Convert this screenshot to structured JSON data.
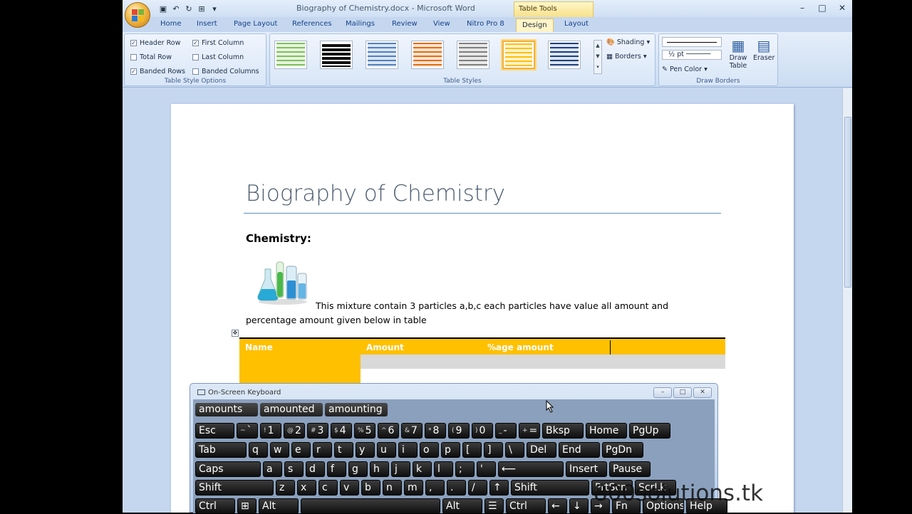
{
  "window": {
    "title": "Biography of Chemistry.docx - Microsoft Word",
    "contextual_header": "Table Tools",
    "controls": [
      "–",
      "□",
      "✕"
    ]
  },
  "tabs": [
    "Home",
    "Insert",
    "Page Layout",
    "References",
    "Mailings",
    "Review",
    "View",
    "Nitro Pro 8",
    "Design",
    "Layout"
  ],
  "active_tab": "Design",
  "ribbon": {
    "table_style_options": {
      "label": "Table Style Options",
      "header_row": "Header Row",
      "first_column": "First Column",
      "total_row": "Total Row",
      "last_column": "Last Column",
      "banded_rows": "Banded Rows",
      "banded_columns": "Banded Columns"
    },
    "table_styles": {
      "label": "Table Styles",
      "shading": "Shading",
      "borders": "Borders"
    },
    "draw_borders": {
      "label": "Draw Borders",
      "pen_weight": "½ pt",
      "pen_color": "Pen Color",
      "draw_table": "Draw Table",
      "eraser": "Eraser"
    }
  },
  "document": {
    "title": "Biography of Chemistry",
    "subheading": "Chemistry:",
    "para_line1": "This mixture contain 3 particles  a,b,c each particles have value all amount and",
    "para_line2": "percentage amount given below in table",
    "table_headers": [
      "Name",
      "Amount",
      "%age amount"
    ]
  },
  "osk": {
    "title": "On-Screen Keyboard",
    "suggestions": [
      "amounts",
      "amounted",
      "amounting"
    ],
    "row1": [
      {
        "s": "",
        "m": "Esc"
      },
      {
        "s": "~",
        "m": "`"
      },
      {
        "s": "!",
        "m": "1"
      },
      {
        "s": "@",
        "m": "2"
      },
      {
        "s": "#",
        "m": "3"
      },
      {
        "s": "$",
        "m": "4"
      },
      {
        "s": "%",
        "m": "5"
      },
      {
        "s": "^",
        "m": "6"
      },
      {
        "s": "&",
        "m": "7"
      },
      {
        "s": "*",
        "m": "8"
      },
      {
        "s": "(",
        "m": "9"
      },
      {
        "s": ")",
        "m": "0"
      },
      {
        "s": "_",
        "m": "-"
      },
      {
        "s": "+",
        "m": "="
      },
      {
        "s": "",
        "m": "Bksp"
      },
      {
        "s": "",
        "m": "Home"
      },
      {
        "s": "",
        "m": "PgUp"
      }
    ],
    "row2": [
      "Tab",
      "q",
      "w",
      "e",
      "r",
      "t",
      "y",
      "u",
      "i",
      "o",
      "p",
      "[",
      "]",
      "\\",
      "Del",
      "End",
      "PgDn"
    ],
    "row3": [
      "Caps",
      "a",
      "s",
      "d",
      "f",
      "g",
      "h",
      "j",
      "k",
      "l",
      ";",
      "'",
      "⟵",
      "Insert",
      "Pause"
    ],
    "row4": [
      "Shift",
      "z",
      "x",
      "c",
      "v",
      "b",
      "n",
      "m",
      ",",
      ".",
      "/",
      "↑",
      "Shift",
      "PrtScn",
      "ScrLk"
    ],
    "row5": [
      "Ctrl",
      "⊞",
      "Alt",
      "",
      "Alt",
      "☰",
      "Ctrl",
      "←",
      "↓",
      "→",
      "Fn",
      "Options",
      "Help"
    ]
  },
  "watermark": "800solutions.tk"
}
